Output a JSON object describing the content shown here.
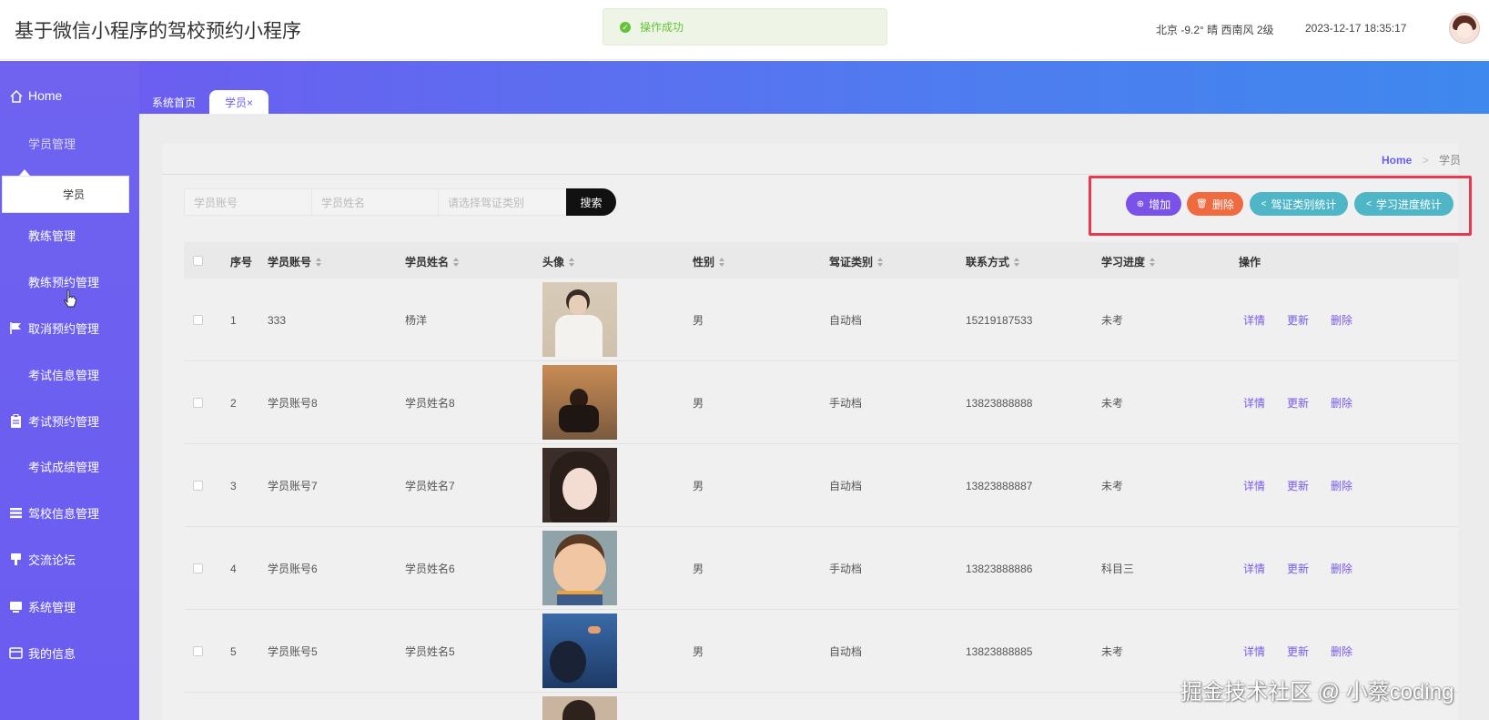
{
  "header": {
    "title": "基于微信小程序的驾校预约小程序",
    "toast": "操作成功",
    "weather": "北京  -9.2°  晴  西南风  2级",
    "datetime": "2023-12-17 18:35:17"
  },
  "sidebar": {
    "items": [
      {
        "label": "Home",
        "icon": "home-icon"
      },
      {
        "label": "学员管理",
        "icon": "grid-icon"
      },
      {
        "label": "教练管理",
        "icon": "grid-icon"
      },
      {
        "label": "教练预约管理",
        "icon": "grid-icon"
      },
      {
        "label": "取消预约管理",
        "icon": "flag-icon"
      },
      {
        "label": "考试信息管理",
        "icon": "grid-icon"
      },
      {
        "label": "考试预约管理",
        "icon": "clipboard-icon"
      },
      {
        "label": "考试成绩管理",
        "icon": "grid-icon"
      },
      {
        "label": "驾校信息管理",
        "icon": "list-icon"
      },
      {
        "label": "交流论坛",
        "icon": "pin-icon"
      },
      {
        "label": "系统管理",
        "icon": "monitor-icon"
      },
      {
        "label": "我的信息",
        "icon": "card-icon"
      }
    ],
    "submenu": "学员"
  },
  "tabs": {
    "home": "系统首页",
    "active": "学员×"
  },
  "breadcrumb": {
    "home": "Home",
    "sep": ">",
    "current": "学员"
  },
  "search": {
    "account_placeholder": "学员账号",
    "name_placeholder": "学员姓名",
    "type_placeholder": "请选择驾证类别",
    "button": "搜索"
  },
  "actions": {
    "add": "增加",
    "delete": "删除",
    "stat_type": "驾证类别统计",
    "stat_progress": "学习进度统计"
  },
  "table": {
    "headers": [
      "序号",
      "学员账号",
      "学员姓名",
      "头像",
      "性别",
      "驾证类别",
      "联系方式",
      "学习进度",
      "操作"
    ],
    "ops": [
      "详情",
      "更新",
      "删除"
    ],
    "rows": [
      {
        "no": "1",
        "account": "333",
        "name": "杨洋",
        "gender": "男",
        "type": "自动档",
        "phone": "15219187533",
        "progress": "未考"
      },
      {
        "no": "2",
        "account": "学员账号8",
        "name": "学员姓名8",
        "gender": "男",
        "type": "手动档",
        "phone": "13823888888",
        "progress": "未考"
      },
      {
        "no": "3",
        "account": "学员账号7",
        "name": "学员姓名7",
        "gender": "男",
        "type": "自动档",
        "phone": "13823888887",
        "progress": "未考"
      },
      {
        "no": "4",
        "account": "学员账号6",
        "name": "学员姓名6",
        "gender": "男",
        "type": "手动档",
        "phone": "13823888886",
        "progress": "科目三"
      },
      {
        "no": "5",
        "account": "学员账号5",
        "name": "学员姓名5",
        "gender": "男",
        "type": "自动档",
        "phone": "13823888885",
        "progress": "未考"
      }
    ]
  },
  "watermark": "掘金技术社区 @ 小蔡coding"
}
